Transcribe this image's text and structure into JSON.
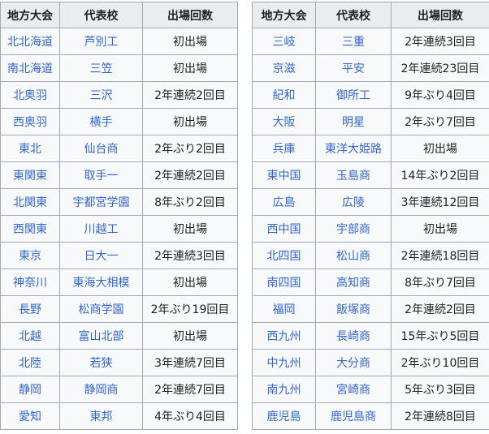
{
  "headers": {
    "region": "地方大会",
    "school": "代表校",
    "appearances": "出場回数"
  },
  "left_rows": [
    {
      "region": "北北海道",
      "school": "芦別工",
      "appearances": "初出場"
    },
    {
      "region": "南北海道",
      "school": "三笠",
      "appearances": "初出場"
    },
    {
      "region": "北奥羽",
      "school": "三沢",
      "appearances": "2年連続2回目"
    },
    {
      "region": "西奥羽",
      "school": "横手",
      "appearances": "初出場"
    },
    {
      "region": "東北",
      "school": "仙台商",
      "appearances": "2年ぶり2回目"
    },
    {
      "region": "東関東",
      "school": "取手一",
      "appearances": "2年連続2回目"
    },
    {
      "region": "北関東",
      "school": "宇都宮学園",
      "appearances": "8年ぶり2回目"
    },
    {
      "region": "西関東",
      "school": "川越工",
      "appearances": "初出場"
    },
    {
      "region": "東京",
      "school": "日大一",
      "appearances": "2年連続3回目"
    },
    {
      "region": "神奈川",
      "school": "東海大相模",
      "appearances": "初出場"
    },
    {
      "region": "長野",
      "school": "松商学園",
      "appearances": "2年ぶり19回目"
    },
    {
      "region": "北越",
      "school": "富山北部",
      "appearances": "初出場"
    },
    {
      "region": "北陸",
      "school": "若狭",
      "appearances": "3年連続7回目"
    },
    {
      "region": "静岡",
      "school": "静岡商",
      "appearances": "2年連続7回目"
    },
    {
      "region": "愛知",
      "school": "東邦",
      "appearances": "4年ぶり4回目"
    }
  ],
  "right_rows": [
    {
      "region": "三岐",
      "school": "三重",
      "appearances": "2年連続3回目"
    },
    {
      "region": "京滋",
      "school": "平安",
      "appearances": "2年連続23回目"
    },
    {
      "region": "紀和",
      "school": "御所工",
      "appearances": "9年ぶり4回目"
    },
    {
      "region": "大阪",
      "school": "明星",
      "appearances": "2年ぶり7回目"
    },
    {
      "region": "兵庫",
      "school": "東洋大姫路",
      "appearances": "初出場"
    },
    {
      "region": "東中国",
      "school": "玉島商",
      "appearances": "14年ぶり2回目"
    },
    {
      "region": "広島",
      "school": "広陵",
      "appearances": "3年連続12回目"
    },
    {
      "region": "西中国",
      "school": "宇部商",
      "appearances": "初出場"
    },
    {
      "region": "北四国",
      "school": "松山商",
      "appearances": "2年連続18回目"
    },
    {
      "region": "南四国",
      "school": "高知商",
      "appearances": "8年ぶり7回目"
    },
    {
      "region": "福岡",
      "school": "飯塚商",
      "appearances": "2年連続2回目"
    },
    {
      "region": "西九州",
      "school": "長崎商",
      "appearances": "15年ぶり5回目"
    },
    {
      "region": "中九州",
      "school": "大分商",
      "appearances": "2年ぶり10回目"
    },
    {
      "region": "南九州",
      "school": "宮崎商",
      "appearances": "5年ぶり3回目"
    },
    {
      "region": "鹿児島",
      "school": "鹿児島商",
      "appearances": "2年連続8回目"
    }
  ]
}
